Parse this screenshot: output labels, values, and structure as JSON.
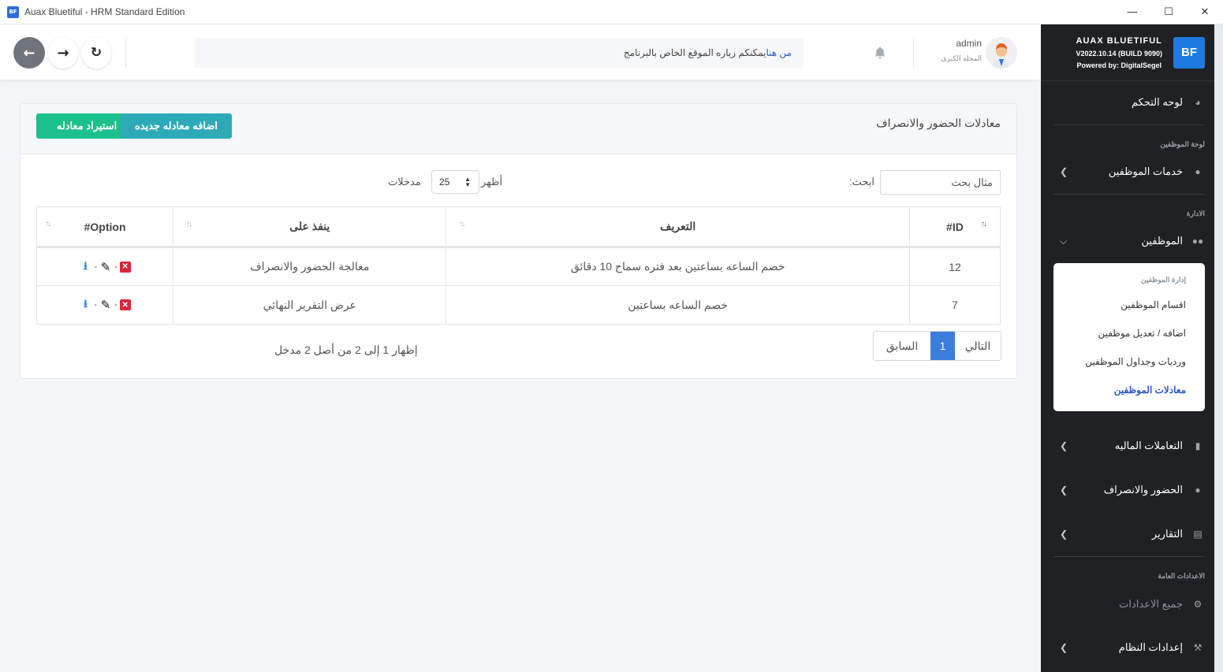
{
  "window": {
    "title": "Auax Bluetiful - HRM Standard Edition",
    "icon_text": "BF"
  },
  "navbar": {
    "notice_text": "يمكنكم زياره الموقع الخاص بالبرنامج",
    "notice_link": "من هنا",
    "user_name": "admin",
    "user_role": "المحله الكبرى"
  },
  "sidebar": {
    "brand_name": "AUAX BLUETIFUL",
    "brand_version": "V2022.10.14 (BUILD 9090)",
    "brand_powered": "Powered by: DigitalSegel",
    "brand_logo": "BF",
    "dashboard": "لوحه التحكم",
    "heading_employees_panel": "لوحة الموظفين",
    "employee_services": "خدمات الموظفين",
    "heading_admin": "الادارة",
    "employees": "الموظفين",
    "submenu": {
      "heading": "إدارة الموظفين",
      "items": [
        "اقسام الموظفين",
        "اضافه / تعديل موظفين",
        "ورديات وجداول الموظفين",
        "معادلات الموظفين"
      ]
    },
    "financial": "التعاملات الماليه",
    "attendance": "الحضور والانصراف",
    "reports": "التقارير",
    "heading_general_settings": "الاعدادات العامة",
    "all_settings": "جميع الاعدادات",
    "system_settings": "إعدادات النظام"
  },
  "card": {
    "title": "معادلات الحضور والانصراف",
    "btn_add": "اضافه معادله جديده",
    "btn_import": "استيراد معادله",
    "search_label": ":ابحث",
    "search_placeholder": "مثال بحث",
    "length_show": "أظهر",
    "length_value": "25",
    "length_entries": "مدخلات",
    "columns": {
      "option": "#Option",
      "applies_on": "ينفذ على",
      "definition": "التعريف",
      "id": "#ID"
    },
    "rows": [
      {
        "applies_on": "معالجة الحضور والانصراف",
        "definition": "خصم الساعه بساعتين بعد فتره سماح 10 دقائق",
        "id": "12"
      },
      {
        "applies_on": "عرض التقرير النهائي",
        "definition": "خصم الساعه بساعتين",
        "id": "7"
      }
    ],
    "pager": {
      "prev": "السابق",
      "current": "1",
      "next": "التالي"
    },
    "info": "إظهار 1 إلى 2 من أصل 2 مدخل"
  },
  "colors": {
    "sidebar_bg": "#1f2124",
    "green_button": "#1cc08a",
    "teal_button": "#2ea9b7",
    "active_link": "#2b59c3",
    "page_current": "#3b7ddd",
    "delete_icon": "#d9263c"
  },
  "icons": [
    "arrow-left-icon",
    "arrow-right-icon",
    "reload-icon",
    "bell-icon",
    "dashboard-icon",
    "users-icon",
    "money-icon",
    "report-icon",
    "gears-icon",
    "tools-icon",
    "delete-icon",
    "edit-icon",
    "download-icon",
    "chevron-left-icon",
    "chevron-down-icon"
  ]
}
